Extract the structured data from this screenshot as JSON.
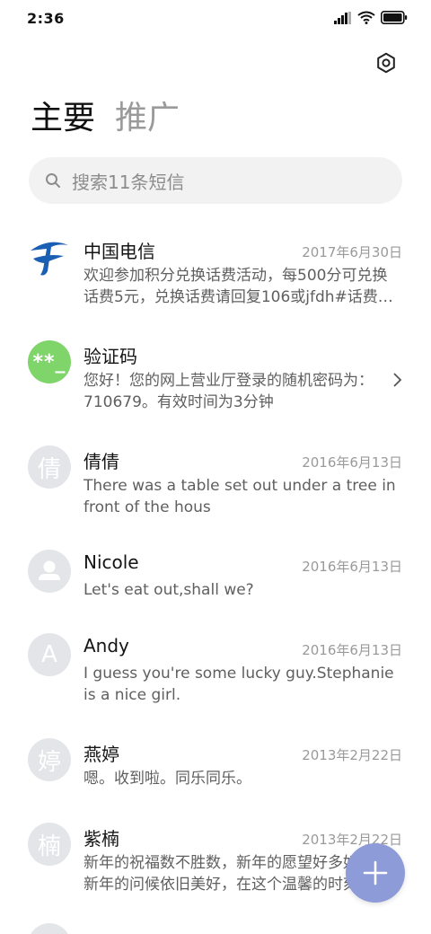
{
  "status_bar": {
    "time": "2:36"
  },
  "header": {
    "tabs": [
      {
        "label": "主要",
        "active": true
      },
      {
        "label": "推广",
        "active": false
      }
    ],
    "settings_icon": "settings-icon"
  },
  "search": {
    "placeholder": "搜索11条短信"
  },
  "conversations": [
    {
      "name": "中国电信",
      "date": "2017年6月30日",
      "preview": "欢迎参加积分兑换话费活动，每500分可兑换话费5元，兑换话费请回复106或jfdh#话费…",
      "avatar": "china-telecom-logo"
    },
    {
      "name": "验证码",
      "date": "",
      "preview": "您好！您的网上营业厅登录的随机密码为：710679。有效时间为3分钟",
      "avatar_text": "**_"
    },
    {
      "name": "倩倩",
      "date": "2016年6月13日",
      "preview": "There was a table set out under a tree in front of the hous",
      "avatar_text": "倩"
    },
    {
      "name": "Nicole",
      "date": "2016年6月13日",
      "preview": "Let's eat out,shall we?",
      "avatar": "person-icon"
    },
    {
      "name": "Andy",
      "date": "2016年6月13日",
      "preview": "I guess you're some lucky guy.Stephanie is a nice girl.",
      "avatar_text": "A"
    },
    {
      "name": "燕婷",
      "date": "2013年2月22日",
      "preview": "嗯。收到啦。同乐同乐。",
      "avatar_text": "婷"
    },
    {
      "name": "紫楠",
      "date": "2013年2月22日",
      "preview": "新年的祝福数不胜数，新年的愿望好多好多，新年的问候依旧美好，在这个温馨的时刻",
      "avatar_text": "楠"
    }
  ],
  "colors": {
    "accent": "#8d9bd9",
    "green_avatar": "#7fd46a",
    "telecom_blue": "#1a5fb4"
  }
}
